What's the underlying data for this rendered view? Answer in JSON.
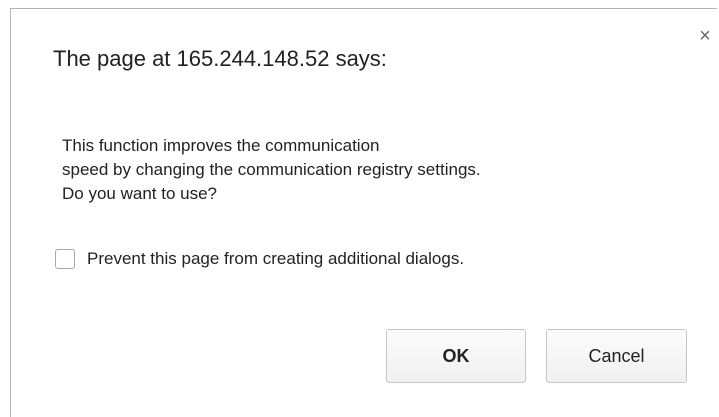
{
  "dialog": {
    "title": "The page at 165.244.148.52 says:",
    "close_symbol": "×",
    "message_lines": [
      "This function improves the communication",
      "speed by changing the communication registry settings.",
      "Do you want to use?"
    ],
    "prevent_checkbox": {
      "label": "Prevent this page from creating additional dialogs.",
      "checked": false
    },
    "buttons": {
      "ok_label": "OK",
      "cancel_label": "Cancel"
    }
  }
}
